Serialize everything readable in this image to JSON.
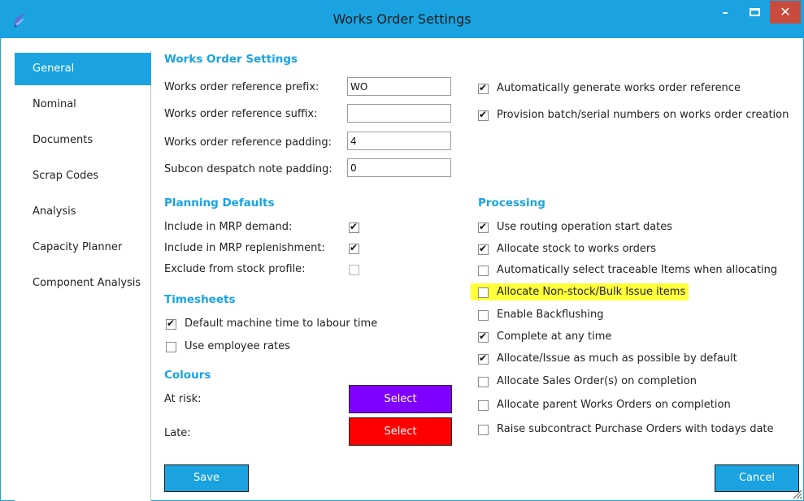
{
  "window": {
    "title": "Works Order Settings",
    "min_label": "–",
    "close_label": "✕"
  },
  "sidebar": {
    "items": [
      {
        "label": "General",
        "active": true
      },
      {
        "label": "Nominal",
        "active": false
      },
      {
        "label": "Documents",
        "active": false
      },
      {
        "label": "Scrap Codes",
        "active": false
      },
      {
        "label": "Analysis",
        "active": false
      },
      {
        "label": "Capacity Planner",
        "active": false
      },
      {
        "label": "Component Analysis",
        "active": false
      }
    ]
  },
  "works_order_settings": {
    "heading": "Works Order Settings",
    "prefix_label": "Works order reference prefix:",
    "prefix_value": "WO",
    "suffix_label": "Works order reference suffix:",
    "suffix_value": "",
    "padding_label": "Works order reference padding:",
    "padding_value": "4",
    "subcon_label": "Subcon despatch note padding:",
    "subcon_value": "0",
    "auto_generate": {
      "label": "Automatically generate works order reference",
      "checked": true
    },
    "provision": {
      "label": "Provision batch/serial numbers on works order creation",
      "checked": true
    }
  },
  "planning_defaults": {
    "heading": "Planning Defaults",
    "items": [
      {
        "label": "Include in MRP demand:",
        "checked": true
      },
      {
        "label": "Include in MRP replenishment:",
        "checked": true
      },
      {
        "label": "Exclude from stock profile:",
        "checked": false
      }
    ]
  },
  "timesheets": {
    "heading": "Timesheets",
    "items": [
      {
        "label": "Default machine time to labour time",
        "checked": true
      },
      {
        "label": "Use employee rates",
        "checked": false
      }
    ]
  },
  "colours": {
    "heading": "Colours",
    "at_risk_label": "At risk:",
    "late_label": "Late:",
    "select_label": "Select",
    "at_risk_color": "#7f00ff",
    "late_color": "#ff0000"
  },
  "processing": {
    "heading": "Processing",
    "items": [
      {
        "label": "Use routing operation start dates",
        "checked": true
      },
      {
        "label": "Allocate stock to works orders",
        "checked": true
      },
      {
        "label": "Automatically select traceable Items when allocating",
        "checked": false
      },
      {
        "label": "Allocate Non-stock/Bulk Issue items",
        "checked": false,
        "highlighted": true
      },
      {
        "label": "Enable Backflushing",
        "checked": false
      },
      {
        "label": "Complete at any time",
        "checked": true
      },
      {
        "label": "Allocate/Issue as much as possible by default",
        "checked": true
      },
      {
        "label": "Allocate Sales Order(s) on completion",
        "checked": false
      },
      {
        "label": "Allocate parent Works Orders on completion",
        "checked": false
      },
      {
        "label": "Raise subcontract Purchase Orders with todays date",
        "checked": false
      }
    ]
  },
  "footer": {
    "save_label": "Save",
    "cancel_label": "Cancel"
  },
  "colors": {
    "accent": "#1aa3e0",
    "close": "#c94b3e",
    "highlight": "#ffff3a"
  }
}
